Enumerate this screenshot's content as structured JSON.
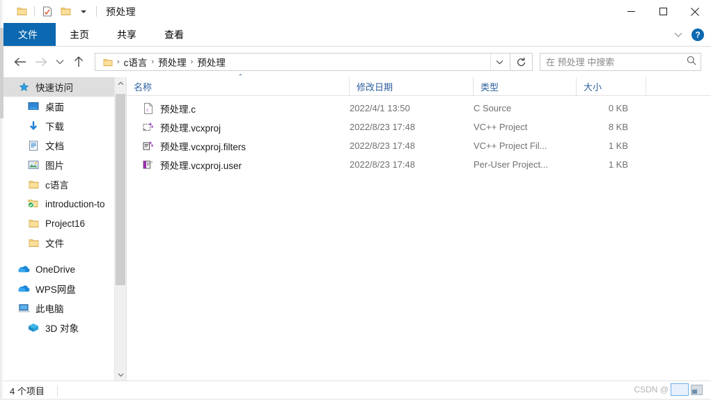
{
  "window": {
    "title": "预处理",
    "minimize_label": "—",
    "maximize_label": "□",
    "close_label": "✕"
  },
  "quick_access_toolbar": {
    "items": [
      {
        "name": "folder-icon",
        "label": "folder-icon"
      },
      {
        "name": "properties-icon",
        "label": "properties-icon"
      },
      {
        "name": "new-folder-icon",
        "label": "new-folder-icon"
      },
      {
        "name": "customize-dropdown-icon",
        "label": "▾"
      }
    ]
  },
  "ribbon": {
    "tabs": [
      {
        "id": "file",
        "label": "文件",
        "selected": true
      },
      {
        "id": "home",
        "label": "主页",
        "selected": false
      },
      {
        "id": "share",
        "label": "共享",
        "selected": false
      },
      {
        "id": "view",
        "label": "查看",
        "selected": false
      }
    ],
    "expand_label": "⌄",
    "help_label": "?",
    "accent_color": "#0c68b0"
  },
  "navigation": {
    "back_label": "←",
    "forward_label": "→",
    "recent_label": "⌄",
    "up_label": "↑",
    "refresh_label": "↻",
    "address_dropdown_label": "⌄"
  },
  "breadcrumb": {
    "separator": "›",
    "parts": [
      "c语言",
      "预处理",
      "预处理"
    ]
  },
  "search": {
    "placeholder": "在 预处理 中搜索",
    "value": "",
    "icon": "search-icon"
  },
  "sidebar": {
    "items": [
      {
        "label": "快速访问",
        "icon": "star-icon",
        "indent": 0,
        "selected": true,
        "pinned": false
      },
      {
        "label": "桌面",
        "icon": "desktop-icon",
        "indent": 1,
        "selected": false,
        "pinned": true
      },
      {
        "label": "下载",
        "icon": "download-icon",
        "indent": 1,
        "selected": false,
        "pinned": true
      },
      {
        "label": "文档",
        "icon": "documents-icon",
        "indent": 1,
        "selected": false,
        "pinned": true
      },
      {
        "label": "图片",
        "icon": "pictures-icon",
        "indent": 1,
        "selected": false,
        "pinned": true
      },
      {
        "label": "c语言",
        "icon": "folder-icon",
        "indent": 1,
        "selected": false,
        "pinned": false
      },
      {
        "label": "introduction-to",
        "icon": "synced-folder-icon",
        "indent": 1,
        "selected": false,
        "pinned": false
      },
      {
        "label": "Project16",
        "icon": "folder-icon",
        "indent": 1,
        "selected": false,
        "pinned": false
      },
      {
        "label": "文件",
        "icon": "folder-icon",
        "indent": 1,
        "selected": false,
        "pinned": false
      },
      {
        "label": "OneDrive",
        "icon": "onedrive-icon",
        "indent": 0,
        "selected": false,
        "pinned": false
      },
      {
        "label": "WPS网盘",
        "icon": "wps-cloud-icon",
        "indent": 0,
        "selected": false,
        "pinned": false
      },
      {
        "label": "此电脑",
        "icon": "this-pc-icon",
        "indent": 0,
        "selected": false,
        "pinned": false
      },
      {
        "label": "3D 对象",
        "icon": "3d-objects-icon",
        "indent": 1,
        "selected": false,
        "pinned": false
      }
    ],
    "scroll_up_label": "⌃",
    "scroll_down_label": "⌄"
  },
  "file_list": {
    "columns": [
      {
        "key": "name",
        "label": "名称",
        "sorted": "asc"
      },
      {
        "key": "date",
        "label": "修改日期",
        "sorted": ""
      },
      {
        "key": "type",
        "label": "类型",
        "sorted": ""
      },
      {
        "key": "size",
        "label": "大小",
        "sorted": ""
      }
    ],
    "sort_caret": "⌃",
    "rows": [
      {
        "name": "预处理.c",
        "date": "2022/4/1 13:50",
        "type": "C Source",
        "size": "0 KB",
        "icon": "c-source-file-icon"
      },
      {
        "name": "预处理.vcxproj",
        "date": "2022/8/23 17:48",
        "type": "VC++ Project",
        "size": "8 KB",
        "icon": "vcxproj-file-icon"
      },
      {
        "name": "预处理.vcxproj.filters",
        "date": "2022/8/23 17:48",
        "type": "VC++ Project Fil...",
        "size": "1 KB",
        "icon": "vcxproj-filters-file-icon"
      },
      {
        "name": "预处理.vcxproj.user",
        "date": "2022/8/23 17:48",
        "type": "Per-User Project...",
        "size": "1 KB",
        "icon": "vcxproj-user-file-icon"
      }
    ]
  },
  "status_bar": {
    "item_count": "4 个项目"
  },
  "watermark": {
    "text": "CSDN @"
  }
}
